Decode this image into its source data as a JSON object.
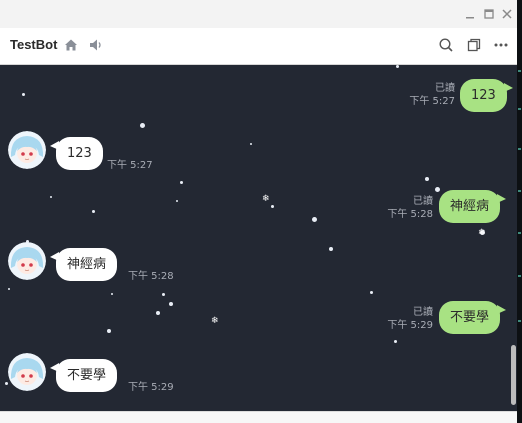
{
  "header": {
    "title": "TestBot"
  },
  "icons": {
    "home": "home-icon",
    "speaker": "speaker-icon",
    "search": "search-icon",
    "notes": "copy-icon",
    "more": "more-icon"
  },
  "colors": {
    "background": "#232833",
    "outgoing_bubble": "#a8e283",
    "incoming_bubble": "#ffffff",
    "meta_text": "#a9adb6"
  },
  "messages": [
    {
      "direction": "out",
      "text": "123",
      "read": "已讀",
      "time": "下午 5:27"
    },
    {
      "direction": "in",
      "text": "123",
      "time": "下午 5:27"
    },
    {
      "direction": "out",
      "text": "神經病",
      "read": "已讀",
      "time": "下午 5:28"
    },
    {
      "direction": "in",
      "text": "神經病",
      "time": "下午 5:28"
    },
    {
      "direction": "out",
      "text": "不要學",
      "read": "已讀",
      "time": "下午 5:29"
    },
    {
      "direction": "in",
      "text": "不要學",
      "time": "下午 5:29"
    }
  ]
}
